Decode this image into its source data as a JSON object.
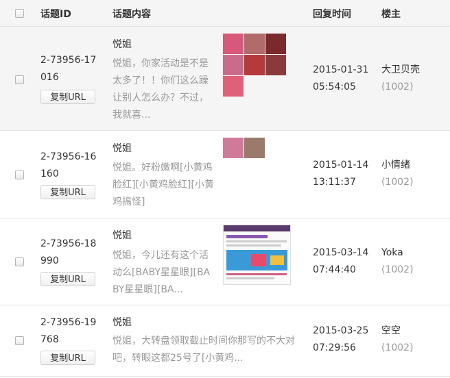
{
  "header": {
    "col_id": "话题ID",
    "col_content": "话题内容",
    "col_reply_time": "回复时间",
    "col_owner": "楼主"
  },
  "copy_label": "复制URL",
  "rows": [
    {
      "topic_id": "2-73956-17016",
      "author": "悦姐",
      "content": "悦姐，你家活动是不是太多了！！你们这么躁让别人怎么办？不过，我就喜...",
      "date": "2015-01-31",
      "time": "05:54:05",
      "owner": "大卫贝壳",
      "owner_count": "(1002)",
      "thumb_colors": [
        "#d8587a",
        "#b36a6a",
        "#7a2a2a",
        "#c96b8a",
        "#b53a3a",
        "#8a3a3a",
        "#e0607a"
      ]
    },
    {
      "topic_id": "2-73956-16160",
      "author": "悦姐",
      "content": "悦姐。好粉嫩啊[小黄鸡脸红][小黄鸡脸红][小黄鸡搞怪]",
      "date": "2015-01-14",
      "time": "13:11:37",
      "owner": "小情绪",
      "owner_count": "(1002)",
      "thumb_colors": [
        "#d07a9a",
        "#9a7a6a"
      ]
    },
    {
      "topic_id": "2-73956-18990",
      "author": "悦姐",
      "content": "悦姐，今儿还有这个活动么[BABY星星眼][BABY星星眼][BA...",
      "date": "2015-03-14",
      "time": "07:44:40",
      "owner": "Yoka",
      "owner_count": "(1002)"
    },
    {
      "topic_id": "2-73956-19768",
      "author": "悦姐",
      "content": "悦姐，大转盘领取截止时间你那写的不大对吧，转眼这都25号了[小黄鸡...",
      "date": "2015-03-25",
      "time": "07:29:56",
      "owner": "空空",
      "owner_count": "(1002)"
    }
  ]
}
